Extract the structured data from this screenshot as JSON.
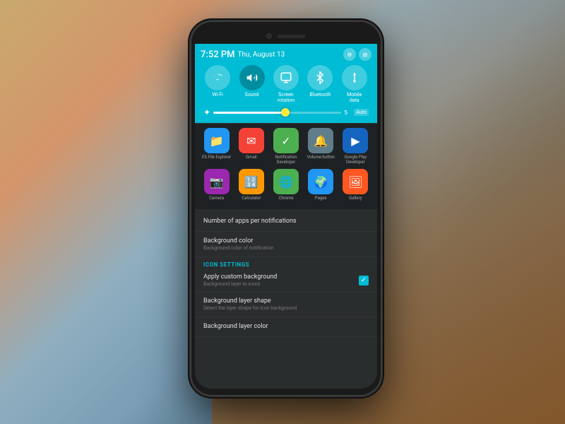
{
  "background": {
    "gradient": "sunset blurred background"
  },
  "phone": {
    "screen": {
      "quick_panel": {
        "status_bar": {
          "time": "7:52 PM",
          "date": "Thu, August 13",
          "icons": [
            "settings-icon",
            "grid-icon"
          ]
        },
        "toggles": [
          {
            "label": "Wi-Fi",
            "icon": "wifi",
            "symbol": "📶",
            "active": false
          },
          {
            "label": "Sound",
            "icon": "sound",
            "symbol": "🔊",
            "active": true
          },
          {
            "label": "Screen rotation",
            "icon": "rotation",
            "symbol": "↻",
            "active": false
          },
          {
            "label": "Bluetooth",
            "icon": "bluetooth",
            "symbol": "⚡",
            "active": false
          },
          {
            "label": "Mobile data",
            "icon": "data",
            "symbol": "↕",
            "active": false
          }
        ],
        "brightness": {
          "value": "5",
          "auto_label": "Auto"
        }
      },
      "app_rows": [
        [
          {
            "label": "ES File Explorer",
            "color": "#2196F3"
          },
          {
            "label": "Gmail",
            "color": "#F44336"
          },
          {
            "label": "Notification\nDeveloper",
            "color": "#4CAF50"
          },
          {
            "label": "Volume button",
            "color": "#607D8B"
          },
          {
            "label": "Google Play\nDeveloper",
            "color": "#1565C0"
          }
        ],
        [
          {
            "label": "Camera",
            "color": "#9C27B0"
          },
          {
            "label": "Calculator",
            "color": "#FF9800"
          },
          {
            "label": "Chrome",
            "color": "#4CAF50"
          },
          {
            "label": "Pages",
            "color": "#2196F3"
          },
          {
            "label": "Gallery",
            "color": "#FF5722"
          }
        ]
      ],
      "settings": {
        "section_header": "ICON SETTINGS",
        "items": [
          {
            "title": "Number of apps per notification",
            "subtitle": ""
          },
          {
            "title": "Background color",
            "subtitle": "Background color of notification"
          },
          {
            "section": "ICON SETTINGS"
          },
          {
            "title": "Apply custom background",
            "subtitle": "Background layer to icons",
            "has_checkbox": true,
            "checked": true
          },
          {
            "title": "Background layer shape",
            "subtitle": "Select the layer shape for icon background"
          },
          {
            "title": "Background layer color",
            "subtitle": ""
          }
        ]
      }
    }
  }
}
